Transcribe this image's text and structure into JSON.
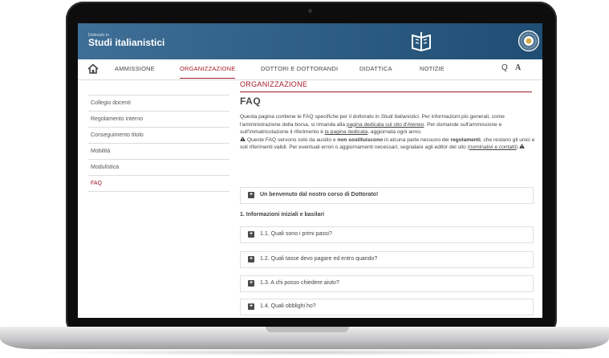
{
  "header": {
    "small_label": "Dottorato in",
    "title": "Studi italianistici",
    "brand_color": "#2d5c84"
  },
  "nav": {
    "items": [
      "AMMISSIONE",
      "ORGANIZZAZIONE",
      "DOTTORI E DOTTORANDI",
      "DIDATTICA",
      "NOTIZIE"
    ],
    "active": "ORGANIZZAZIONE",
    "search_glyph": "Q",
    "font_glyph": "A",
    "accent_color": "#a51a2a"
  },
  "sidebar": {
    "items": [
      "Collegio docenti",
      "Regolamento interno",
      "Conseguimento titolo",
      "Mobilità",
      "Modulistica",
      "FAQ"
    ],
    "active": "FAQ"
  },
  "main": {
    "section": "ORGANIZZAZIONE",
    "title": "FAQ",
    "intro": {
      "p1_a": "Questa pagina contiene le FAQ specifiche per il dottorato in ",
      "p1_em": "Studi Italianistici",
      "p1_b": ". Per informazioni più generali, come l'amministrazione della borsa, si rimanda alla ",
      "p1_link1": "pagina dedicata sul sito d'Ateneo",
      "p1_c": ". Per domande sull'ammissione e sull'immatricolazione il riferimento è ",
      "p1_link2": "la pagina dedicata",
      "p1_d": ", aggiornata ogni anno.",
      "p2_a": " Queste FAQ servono solo da ausilio e ",
      "p2_bold1": "non sostituiscono",
      "p2_b": " in alcuna parte nessuno dei ",
      "p2_bold2": "regolamenti",
      "p2_c": ", che restano gli unici e soli riferimenti validi. Per eventuali errori o aggiornamenti necessari, segnalare agli ",
      "p2_em": "editor",
      "p2_d": " del sito (",
      "p2_link": "nominativi e contatti",
      "p2_e": ") "
    },
    "welcome": "Un benvenuto dal nostro corso di Dottorato!",
    "group_title": "1. Informazioni iniziali e basilari",
    "faqs": [
      "1.1. Quali sono i primi passi?",
      "1.2. Quali tasse devo pagare ed entro quando?",
      "1.3. A chi posso chiedere aiuto?",
      "1.4. Quali obblighi ho?"
    ]
  },
  "icons": {
    "home": "home-icon",
    "logo": "book-logo-icon",
    "seal": "university-seal-icon",
    "search": "search-icon",
    "font_size": "font-size-icon",
    "expand": "plus-square-icon",
    "warning": "warning-icon"
  }
}
